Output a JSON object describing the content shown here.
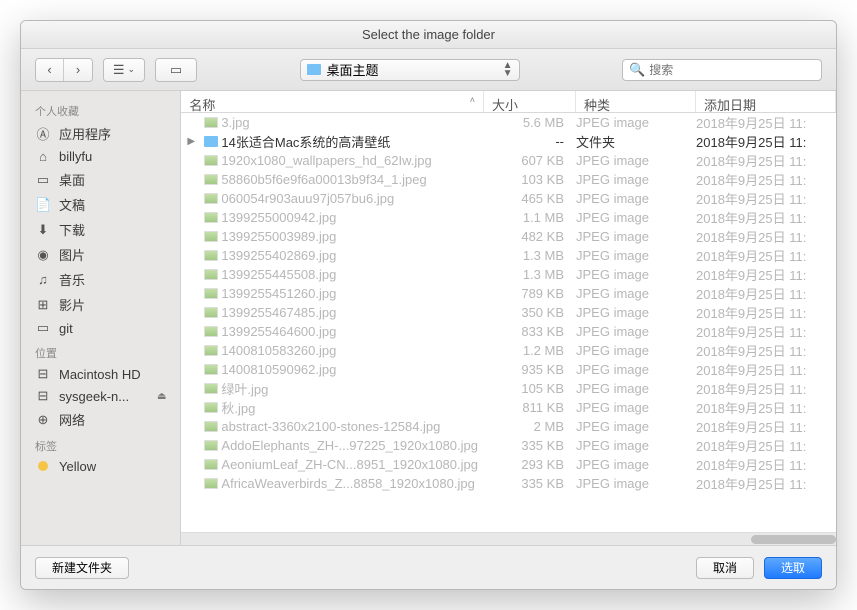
{
  "title": "Select the image folder",
  "path_selector": {
    "icon": "folder",
    "label": "桌面主题"
  },
  "search": {
    "placeholder": "搜索"
  },
  "sidebar": {
    "sections": [
      {
        "header": "个人收藏",
        "items": [
          {
            "icon": "apps",
            "label": "应用程序"
          },
          {
            "icon": "home",
            "label": "billyfu"
          },
          {
            "icon": "desktop",
            "label": "桌面"
          },
          {
            "icon": "doc",
            "label": "文稿"
          },
          {
            "icon": "download",
            "label": "下载"
          },
          {
            "icon": "image",
            "label": "图片"
          },
          {
            "icon": "music",
            "label": "音乐"
          },
          {
            "icon": "movie",
            "label": "影片"
          },
          {
            "icon": "folder",
            "label": "git"
          }
        ]
      },
      {
        "header": "位置",
        "items": [
          {
            "icon": "disk",
            "label": "Macintosh HD"
          },
          {
            "icon": "disk",
            "label": "sysgeek-n...",
            "eject": true
          },
          {
            "icon": "globe",
            "label": "网络"
          }
        ]
      },
      {
        "header": "标签",
        "items": [
          {
            "icon": "tag-yellow",
            "label": "Yellow"
          }
        ]
      }
    ]
  },
  "columns": {
    "name": "名称",
    "size": "大小",
    "kind": "种类",
    "date": "添加日期"
  },
  "rows": [
    {
      "dim": true,
      "disclosure": false,
      "folder": false,
      "name": "3.jpg",
      "size": "5.6 MB",
      "kind": "JPEG image",
      "date": "2018年9月25日 11:"
    },
    {
      "dim": false,
      "disclosure": true,
      "folder": true,
      "name": "14张适合Mac系统的高清壁纸",
      "size": "--",
      "kind": "文件夹",
      "date": "2018年9月25日 11:"
    },
    {
      "dim": true,
      "disclosure": false,
      "folder": false,
      "name": "1920x1080_wallpapers_hd_62Iw.jpg",
      "size": "607 KB",
      "kind": "JPEG image",
      "date": "2018年9月25日 11:"
    },
    {
      "dim": true,
      "disclosure": false,
      "folder": false,
      "name": "58860b5f6e9f6a00013b9f34_1.jpeg",
      "size": "103 KB",
      "kind": "JPEG image",
      "date": "2018年9月25日 11:"
    },
    {
      "dim": true,
      "disclosure": false,
      "folder": false,
      "name": "060054r903auu97j057bu6.jpg",
      "size": "465 KB",
      "kind": "JPEG image",
      "date": "2018年9月25日 11:"
    },
    {
      "dim": true,
      "disclosure": false,
      "folder": false,
      "name": "1399255000942.jpg",
      "size": "1.1 MB",
      "kind": "JPEG image",
      "date": "2018年9月25日 11:"
    },
    {
      "dim": true,
      "disclosure": false,
      "folder": false,
      "name": "1399255003989.jpg",
      "size": "482 KB",
      "kind": "JPEG image",
      "date": "2018年9月25日 11:"
    },
    {
      "dim": true,
      "disclosure": false,
      "folder": false,
      "name": "1399255402869.jpg",
      "size": "1.3 MB",
      "kind": "JPEG image",
      "date": "2018年9月25日 11:"
    },
    {
      "dim": true,
      "disclosure": false,
      "folder": false,
      "name": "1399255445508.jpg",
      "size": "1.3 MB",
      "kind": "JPEG image",
      "date": "2018年9月25日 11:"
    },
    {
      "dim": true,
      "disclosure": false,
      "folder": false,
      "name": "1399255451260.jpg",
      "size": "789 KB",
      "kind": "JPEG image",
      "date": "2018年9月25日 11:"
    },
    {
      "dim": true,
      "disclosure": false,
      "folder": false,
      "name": "1399255467485.jpg",
      "size": "350 KB",
      "kind": "JPEG image",
      "date": "2018年9月25日 11:"
    },
    {
      "dim": true,
      "disclosure": false,
      "folder": false,
      "name": "1399255464600.jpg",
      "size": "833 KB",
      "kind": "JPEG image",
      "date": "2018年9月25日 11:"
    },
    {
      "dim": true,
      "disclosure": false,
      "folder": false,
      "name": "1400810583260.jpg",
      "size": "1.2 MB",
      "kind": "JPEG image",
      "date": "2018年9月25日 11:"
    },
    {
      "dim": true,
      "disclosure": false,
      "folder": false,
      "name": "1400810590962.jpg",
      "size": "935 KB",
      "kind": "JPEG image",
      "date": "2018年9月25日 11:"
    },
    {
      "dim": true,
      "disclosure": false,
      "folder": false,
      "name": "绿叶.jpg",
      "size": "105 KB",
      "kind": "JPEG image",
      "date": "2018年9月25日 11:"
    },
    {
      "dim": true,
      "disclosure": false,
      "folder": false,
      "name": "秋.jpg",
      "size": "811 KB",
      "kind": "JPEG image",
      "date": "2018年9月25日 11:"
    },
    {
      "dim": true,
      "disclosure": false,
      "folder": false,
      "name": "abstract-3360x2100-stones-12584.jpg",
      "size": "2 MB",
      "kind": "JPEG image",
      "date": "2018年9月25日 11:"
    },
    {
      "dim": true,
      "disclosure": false,
      "folder": false,
      "name": "AddoElephants_ZH-...97225_1920x1080.jpg",
      "size": "335 KB",
      "kind": "JPEG image",
      "date": "2018年9月25日 11:"
    },
    {
      "dim": true,
      "disclosure": false,
      "folder": false,
      "name": "AeoniumLeaf_ZH-CN...8951_1920x1080.jpg",
      "size": "293 KB",
      "kind": "JPEG image",
      "date": "2018年9月25日 11:"
    },
    {
      "dim": true,
      "disclosure": false,
      "folder": false,
      "name": "AfricaWeaverbirds_Z...8858_1920x1080.jpg",
      "size": "335 KB",
      "kind": "JPEG image",
      "date": "2018年9月25日 11:"
    }
  ],
  "footer": {
    "newFolder": "新建文件夹",
    "cancel": "取消",
    "choose": "选取"
  }
}
